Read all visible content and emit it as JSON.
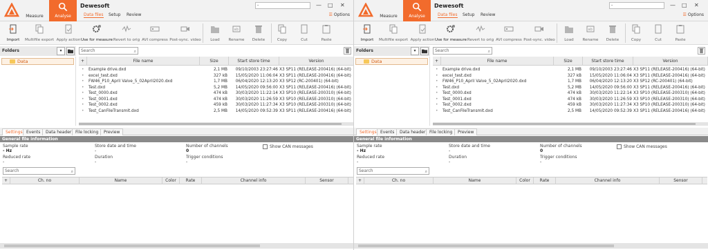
{
  "colors": {
    "accent": "#f26b2c",
    "folder": "#f7c85a"
  },
  "panes": [
    {
      "app": {
        "title": "Dewesoft",
        "modes": [
          {
            "label": "Measure",
            "icon": "dewesoft-logo-icon"
          },
          {
            "label": "Analyse",
            "icon": "magnifier-icon"
          }
        ],
        "tabs": [
          "Data files",
          "Setup",
          "Review"
        ],
        "title_input": "-",
        "window_controls": [
          "—",
          "□",
          "✕"
        ],
        "options_label": "Options"
      },
      "toolbar": {
        "items": [
          {
            "label": "Import",
            "icon": "import-icon"
          },
          {
            "label": "Multifile export",
            "icon": "multifile-export-icon"
          },
          {
            "label": "Apply action",
            "icon": "apply-action-icon"
          },
          {
            "label": "Use for measure",
            "icon": "use-for-measure-icon"
          },
          {
            "label": "Revert to orig",
            "icon": "revert-icon"
          },
          {
            "label": "AVI compress",
            "icon": "avi-compress-icon"
          },
          {
            "label": "Post-sync. video",
            "icon": "post-sync-video-icon"
          },
          {
            "label": "Load",
            "icon": "load-icon"
          },
          {
            "label": "Rename",
            "icon": "rename-icon"
          },
          {
            "label": "Delete",
            "icon": "delete-icon"
          },
          {
            "label": "Copy",
            "icon": "copy-icon"
          },
          {
            "label": "Cut",
            "icon": "cut-icon"
          },
          {
            "label": "Paste",
            "icon": "paste-icon"
          }
        ]
      },
      "folders": {
        "label": "Folders",
        "items": [
          "Data"
        ]
      },
      "file_search": {
        "placeholder": "Search"
      },
      "files": {
        "columns": [
          "+",
          "File name",
          "Size",
          "Start store time",
          "Version"
        ],
        "rows": [
          {
            "name": "Example drive.dxd",
            "size": "2,1 MB",
            "date": "09/10/2003 23:27:46",
            "version": "X3 SP11 (RELEASE-200416) (64-bit)"
          },
          {
            "name": "excel_test.dxd",
            "size": "327 kB",
            "date": "15/05/2020 11:06:04",
            "version": "X3 SP11 (RELEASE-200416) (64-bit)"
          },
          {
            "name": "FW46_P10_April Valve_5_02April2020.dxd",
            "size": "1,7 MB",
            "date": "06/04/2020 12:13:20",
            "version": "X3 SP12 (RC-200401) (64-bit)"
          },
          {
            "name": "Test.dxd",
            "size": "5,2 MB",
            "date": "14/05/2020 09:56:00",
            "version": "X3 SP11 (RELEASE-200416) (64-bit)"
          },
          {
            "name": "Test_0000.dxd",
            "size": "474 kB",
            "date": "30/03/2020 11:22:14",
            "version": "X3 SP10 (RELEASE-200310) (64-bit)"
          },
          {
            "name": "Test_0001.dxd",
            "size": "474 kB",
            "date": "30/03/2020 11:26:59",
            "version": "X3 SP10 (RELEASE-200310) (64-bit)"
          },
          {
            "name": "Test_0002.dxd",
            "size": "459 kB",
            "date": "30/03/2020 11:27:34",
            "version": "X3 SP10 (RELEASE-200310) (64-bit)"
          },
          {
            "name": "Test_CanFileTransmit.dxd",
            "size": "2,5 MB",
            "date": "14/05/2020 09:52:39",
            "version": "X3 SP11 (RELEASE-200416) (64-bit)"
          }
        ]
      },
      "lower_tabs": [
        "Settings",
        "Events",
        "Data header",
        "File locking",
        "Preview"
      ],
      "info": {
        "section": "General file information",
        "sample_rate_label": "Sample rate",
        "sample_rate_value": "- Hz",
        "store_date_label": "Store date and time",
        "store_date_value": "-",
        "channels_label": "Number of channels",
        "channels_value": "0",
        "can_label": "Show CAN messages",
        "reduced_rate_label": "Reduced rate",
        "reduced_rate_value": "-",
        "duration_label": "Duration",
        "duration_value": "-",
        "trigger_label": "Trigger conditions",
        "trigger_value": "-"
      },
      "channel_search": {
        "placeholder": "Search"
      },
      "channels": {
        "columns": [
          "+",
          "Ch. no",
          "Name",
          "Color",
          "Rate",
          "Channel info",
          "Sensor"
        ]
      }
    },
    {
      "app": {
        "title": "Dewesoft",
        "modes": [
          {
            "label": "Measure",
            "icon": "dewesoft-logo-icon"
          },
          {
            "label": "Analyse",
            "icon": "magnifier-icon"
          }
        ],
        "tabs": [
          "Data files",
          "Setup",
          "Review"
        ],
        "title_input": "-",
        "window_controls": [
          "—",
          "□",
          "✕"
        ],
        "options_label": "Options"
      },
      "toolbar": {
        "items": [
          {
            "label": "Import",
            "icon": "import-icon"
          },
          {
            "label": "Multifile export",
            "icon": "multifile-export-icon"
          },
          {
            "label": "Apply action",
            "icon": "apply-action-icon"
          },
          {
            "label": "Use for measure",
            "icon": "use-for-measure-icon"
          },
          {
            "label": "Revert to orig",
            "icon": "revert-icon"
          },
          {
            "label": "AVI compress",
            "icon": "avi-compress-icon"
          },
          {
            "label": "Post-sync. video",
            "icon": "post-sync-video-icon"
          },
          {
            "label": "Load",
            "icon": "load-icon"
          },
          {
            "label": "Rename",
            "icon": "rename-icon"
          },
          {
            "label": "Delete",
            "icon": "delete-icon"
          },
          {
            "label": "Copy",
            "icon": "copy-icon"
          },
          {
            "label": "Cut",
            "icon": "cut-icon"
          },
          {
            "label": "Paste",
            "icon": "paste-icon"
          }
        ]
      },
      "folders": {
        "label": "Folders",
        "items": [
          "Data"
        ]
      },
      "file_search": {
        "placeholder": "Search"
      },
      "files": {
        "columns": [
          "+",
          "File name",
          "Size",
          "Start store time",
          "Version"
        ],
        "rows": [
          {
            "name": "Example drive.dxd",
            "size": "2,1 MB",
            "date": "09/10/2003 23:27:46",
            "version": "X3 SP11 (RELEASE-200416) (64-bit)"
          },
          {
            "name": "excel_test.dxd",
            "size": "327 kB",
            "date": "15/05/2020 11:06:04",
            "version": "X3 SP11 (RELEASE-200416) (64-bit)"
          },
          {
            "name": "FW46_P10_April Valve_5_02April2020.dxd",
            "size": "1,7 MB",
            "date": "06/04/2020 12:13:20",
            "version": "X3 SP12 (RC-200401) (64-bit)"
          },
          {
            "name": "Test.dxd",
            "size": "5,2 MB",
            "date": "14/05/2020 09:56:00",
            "version": "X3 SP11 (RELEASE-200416) (64-bit)"
          },
          {
            "name": "Test_0000.dxd",
            "size": "474 kB",
            "date": "30/03/2020 11:22:14",
            "version": "X3 SP10 (RELEASE-200310) (64-bit)"
          },
          {
            "name": "Test_0001.dxd",
            "size": "474 kB",
            "date": "30/03/2020 11:26:59",
            "version": "X3 SP10 (RELEASE-200310) (64-bit)"
          },
          {
            "name": "Test_0002.dxd",
            "size": "459 kB",
            "date": "30/03/2020 11:27:34",
            "version": "X3 SP10 (RELEASE-200310) (64-bit)"
          },
          {
            "name": "Test_CanFileTransmit.dxd",
            "size": "2,5 MB",
            "date": "14/05/2020 09:52:39",
            "version": "X3 SP11 (RELEASE-200416) (64-bit)"
          }
        ]
      },
      "lower_tabs": [
        "Settings",
        "Events",
        "Data header",
        "File locking",
        "Preview"
      ],
      "info": {
        "section": "General file information",
        "sample_rate_label": "Sample rate",
        "sample_rate_value": "- Hz",
        "store_date_label": "Store date and time",
        "store_date_value": "-",
        "channels_label": "Number of channels",
        "channels_value": "0",
        "can_label": "Show CAN messages",
        "reduced_rate_label": "Reduced rate",
        "reduced_rate_value": "-",
        "duration_label": "Duration",
        "duration_value": "-",
        "trigger_label": "Trigger conditions",
        "trigger_value": "-"
      },
      "channel_search": {
        "placeholder": "Search"
      },
      "channels": {
        "columns": [
          "+",
          "Ch. no",
          "Name",
          "Color",
          "Rate",
          "Channel info",
          "Sensor"
        ]
      }
    }
  ]
}
